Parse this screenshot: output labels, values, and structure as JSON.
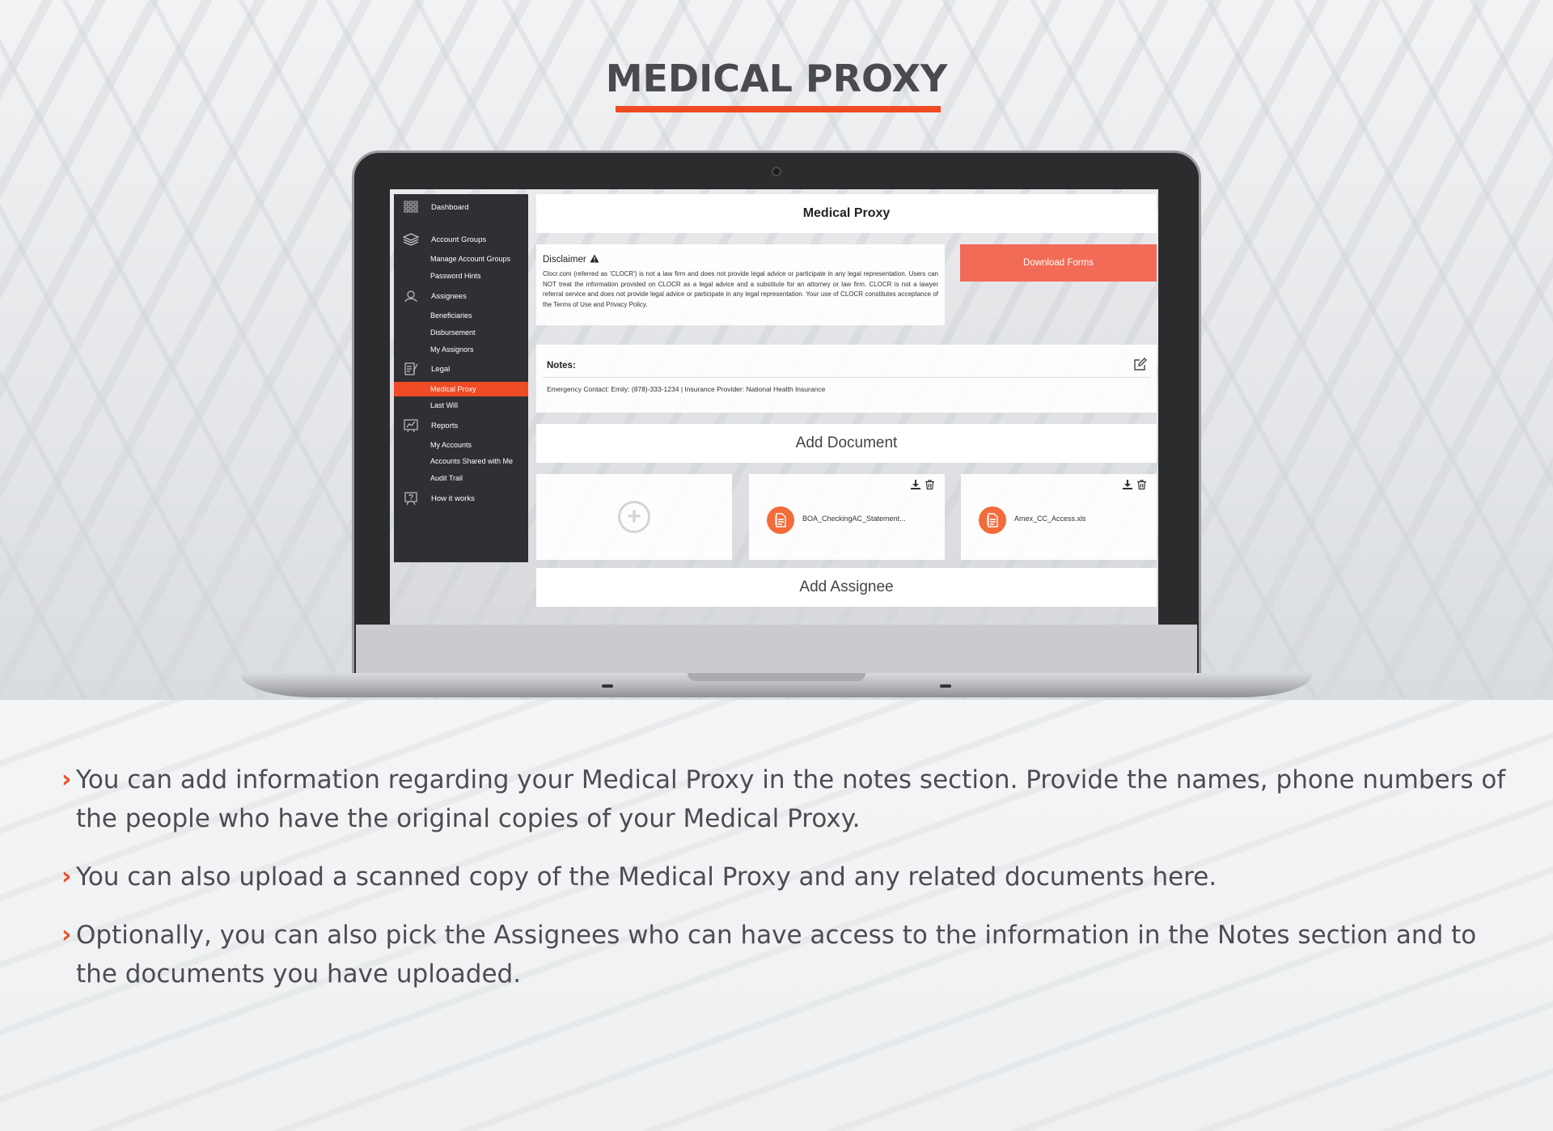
{
  "page": {
    "title": "MEDICAL PROXY",
    "accent_color": "#ef4b24"
  },
  "sidebar": {
    "sections": [
      {
        "label": "Dashboard",
        "icon": "grid-icon"
      },
      {
        "label": "Account Groups",
        "icon": "layers-icon",
        "items": [
          "Manage Account Groups",
          "Password Hints"
        ]
      },
      {
        "label": "Assignees",
        "icon": "assignees-icon",
        "items": [
          "Beneficiaries",
          "Disbursement",
          "My Assignors"
        ]
      },
      {
        "label": "Legal",
        "icon": "legal-document-icon",
        "items": [
          "Medical Proxy",
          "Last Will"
        ]
      },
      {
        "label": "Reports",
        "icon": "reports-chart-icon",
        "items": [
          "My Accounts",
          "Accounts Shared with Me",
          "Audit Trail"
        ]
      },
      {
        "label": "How it works",
        "icon": "help-presentation-icon"
      }
    ],
    "active_item": "Medical Proxy"
  },
  "main": {
    "title": "Medical Proxy",
    "disclaimer": {
      "title": "Disclaimer",
      "text": "Clocr.com (referred as 'CLOCR') is not a law firm and does not provide legal advice or participate in any legal representation. Users can NOT treat the information provided on CLOCR as a legal advice and a substitute for an attorney or law firm. CLOCR is not a lawyer referral service and does not provide legal advice or participate in any legal representation. Your use of CLOCR constitutes acceptance of the Terms of Use and Privacy Policy."
    },
    "download_button": "Download Forms",
    "notes": {
      "label": "Notes:",
      "text": "Emergency Contact: Emily: (878)-333-1234 | Insurance Provider: National Health Insurance"
    },
    "add_document": "Add Document",
    "files": [
      {
        "name": "BOA_CheckingAC_Statement..."
      },
      {
        "name": "Amex_CC_Access.xls"
      }
    ],
    "add_assignee": "Add Assignee"
  },
  "bullets": [
    "You can add information regarding your Medical Proxy in the notes section. Provide the names, phone numbers of the people who have the original copies of your Medical Proxy.",
    "You can also upload a scanned copy of the Medical Proxy and any related documents here.",
    "Optionally, you can also pick the Assignees who can have access to the information in the Notes section and to the documents you have uploaded."
  ]
}
